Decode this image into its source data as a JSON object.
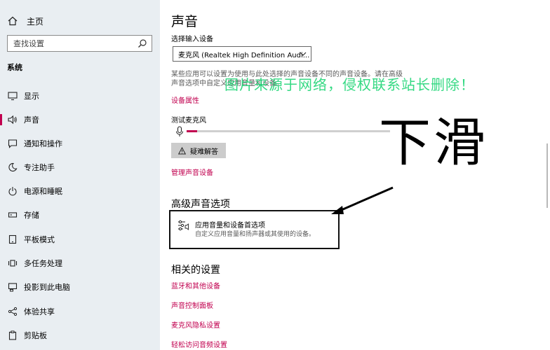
{
  "sidebar": {
    "home": "主页",
    "search_placeholder": "查找设置",
    "section_title": "系统",
    "items": [
      {
        "label": "显示",
        "icon": "monitor-icon"
      },
      {
        "label": "声音",
        "icon": "speaker-icon",
        "active": true
      },
      {
        "label": "通知和操作",
        "icon": "notification-icon"
      },
      {
        "label": "专注助手",
        "icon": "moon-icon"
      },
      {
        "label": "电源和睡眠",
        "icon": "power-icon"
      },
      {
        "label": "存储",
        "icon": "storage-icon"
      },
      {
        "label": "平板模式",
        "icon": "tablet-icon"
      },
      {
        "label": "多任务处理",
        "icon": "multitask-icon"
      },
      {
        "label": "投影到此电脑",
        "icon": "project-icon"
      },
      {
        "label": "体验共享",
        "icon": "share-icon"
      },
      {
        "label": "剪贴板",
        "icon": "clipboard-icon"
      }
    ]
  },
  "main": {
    "title": "声音",
    "input_label": "选择输入设备",
    "input_device": "麦克风 (Realtek High Definition Audi...",
    "description": "某些应用可以设置为使用与此处选择的声音设备不同的声音设备。请在高级声音选项中自定义应用音量和设备。",
    "device_properties": "设备属性",
    "test_mic": "测试麦克风",
    "mic_level_percent": 5,
    "troubleshoot": "疑难解答",
    "manage_devices": "管理声音设备",
    "advanced_title": "高级声音选项",
    "app_volume_title": "应用音量和设备首选项",
    "app_volume_sub": "自定义应用音量和扬声器或其使用的设备。",
    "related_title": "相关的设置",
    "related_links": [
      "蓝牙和其他设备",
      "声音控制面板",
      "麦克风隐私设置",
      "轻松访问音频设置"
    ]
  },
  "overlay": {
    "watermark": "图片来源于网络，侵权联系站长删除！",
    "annotation": "下滑"
  },
  "colors": {
    "accent": "#c1004f",
    "sidebar_bg": "#e9eef2",
    "watermark": "#12d36e"
  }
}
